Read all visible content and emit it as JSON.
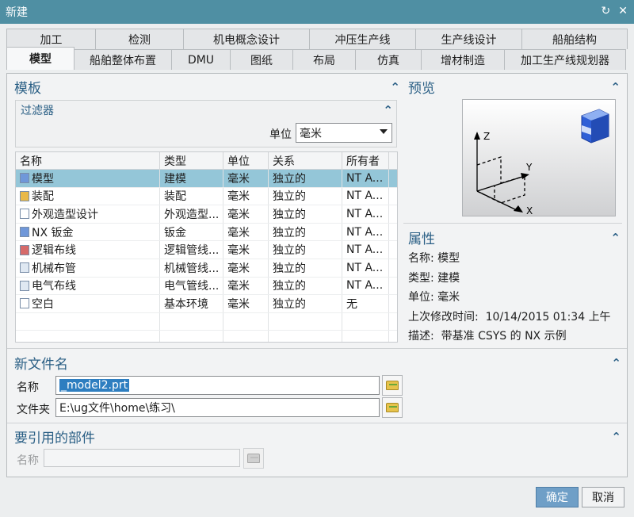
{
  "title": "新建",
  "tabs_row1": [
    "加工",
    "检测",
    "机电概念设计",
    "冲压生产线",
    "生产线设计",
    "船舶结构"
  ],
  "tabs_row2": [
    "模型",
    "船舶整体布置",
    "DMU",
    "图纸",
    "布局",
    "仿真",
    "增材制造",
    "加工生产线规划器"
  ],
  "templates": {
    "title": "模板",
    "filter_title": "过滤器",
    "unit_label": "单位",
    "unit_value": "毫米",
    "columns": [
      "名称",
      "类型",
      "单位",
      "关系",
      "所有者"
    ],
    "rows": [
      {
        "icon": "model-icon",
        "name": "模型",
        "type": "建模",
        "unit": "毫米",
        "relation": "独立的",
        "owner": "NT A..."
      },
      {
        "icon": "assembly-icon",
        "name": "装配",
        "type": "装配",
        "unit": "毫米",
        "relation": "独立的",
        "owner": "NT A..."
      },
      {
        "icon": "shape-design-icon",
        "name": "外观造型设计",
        "type": "外观造型...",
        "unit": "毫米",
        "relation": "独立的",
        "owner": "NT A..."
      },
      {
        "icon": "sheet-metal-icon",
        "name": "NX 钣金",
        "type": "钣金",
        "unit": "毫米",
        "relation": "独立的",
        "owner": "NT A..."
      },
      {
        "icon": "logical-routing-icon",
        "name": "逻辑布线",
        "type": "逻辑管线...",
        "unit": "毫米",
        "relation": "独立的",
        "owner": "NT A..."
      },
      {
        "icon": "mechanical-piping-icon",
        "name": "机械布管",
        "type": "机械管线...",
        "unit": "毫米",
        "relation": "独立的",
        "owner": "NT A..."
      },
      {
        "icon": "electrical-routing-icon",
        "name": "电气布线",
        "type": "电气管线...",
        "unit": "毫米",
        "relation": "独立的",
        "owner": "NT A..."
      },
      {
        "icon": "blank-icon",
        "name": "空白",
        "type": "基本环境",
        "unit": "毫米",
        "relation": "独立的",
        "owner": "无"
      }
    ]
  },
  "preview": {
    "title": "预览",
    "axis_x": "X",
    "axis_y": "Y",
    "axis_z": "Z"
  },
  "properties": {
    "title": "属性",
    "name_label": "名称:",
    "name_value": "模型",
    "type_label": "类型:",
    "type_value": "建模",
    "unit_label": "单位:",
    "unit_value": "毫米",
    "modified_label": "上次修改时间:",
    "modified_value": "10/14/2015 01:34 上午",
    "desc_label": "描述:",
    "desc_value": "带基准 CSYS 的 NX 示例"
  },
  "new_file": {
    "title": "新文件名",
    "name_label": "名称",
    "name_value": "_model2.prt",
    "folder_label": "文件夹",
    "folder_value": "E:\\ug文件\\home\\练习\\"
  },
  "reference": {
    "title": "要引用的部件",
    "name_label": "名称",
    "name_value": ""
  },
  "buttons": {
    "ok": "确定",
    "cancel": "取消"
  },
  "colors": {
    "titlebar": "#4f8fa3",
    "accent": "#2a5f85",
    "selection": "#94c6d8"
  }
}
